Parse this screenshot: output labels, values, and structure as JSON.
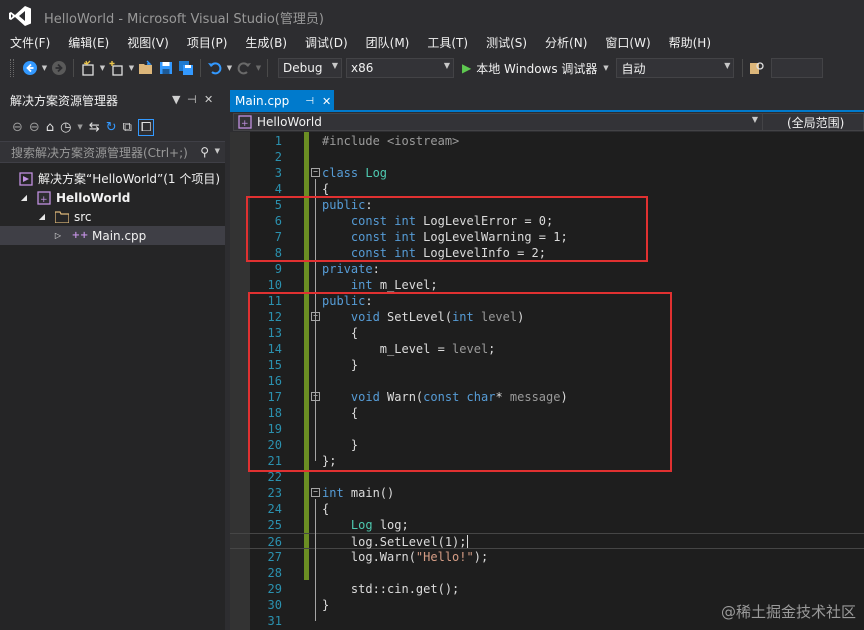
{
  "window": {
    "title": "HelloWorld - Microsoft Visual Studio(管理员)"
  },
  "menu": [
    "文件(F)",
    "编辑(E)",
    "视图(V)",
    "项目(P)",
    "生成(B)",
    "调试(D)",
    "团队(M)",
    "工具(T)",
    "测试(S)",
    "分析(N)",
    "窗口(W)",
    "帮助(H)"
  ],
  "toolbar": {
    "config": "Debug",
    "platform": "x86",
    "run_label": "本地 Windows 调试器",
    "run_mode": "自动"
  },
  "solution_explorer": {
    "title": "解决方案资源管理器",
    "search_placeholder": "搜索解决方案资源管理器(Ctrl+;)",
    "tree": [
      {
        "label": "解决方案“HelloWorld”(1 个项目)",
        "icon": "solution-icon",
        "bold": false
      },
      {
        "label": "HelloWorld",
        "icon": "cpp-project-icon",
        "bold": true
      },
      {
        "label": "src",
        "icon": "folder-icon",
        "bold": false
      },
      {
        "label": "Main.cpp",
        "icon": "cpp-file-icon",
        "bold": false,
        "selected": true
      }
    ]
  },
  "editor": {
    "tab": "Main.cpp",
    "nav_file": "HelloWorld",
    "nav_scope": "(全局范围)",
    "current_line": 26,
    "lines": [
      {
        "n": "1",
        "fold": "",
        "tokens": [
          {
            "t": "#include <iostream>",
            "c": "pp"
          }
        ]
      },
      {
        "n": "2",
        "fold": "",
        "tokens": []
      },
      {
        "n": "3",
        "fold": "minus",
        "tokens": [
          {
            "t": "class",
            "c": "kw"
          },
          {
            "t": " "
          },
          {
            "t": "Log",
            "c": "tp"
          }
        ]
      },
      {
        "n": "4",
        "fold": "",
        "tokens": [
          {
            "t": "{"
          }
        ]
      },
      {
        "n": "5",
        "fold": "",
        "tokens": [
          {
            "t": "public",
            "c": "kw"
          },
          {
            "t": ":"
          }
        ]
      },
      {
        "n": "6",
        "fold": "",
        "tokens": [
          {
            "t": "    "
          },
          {
            "t": "const",
            "c": "kw"
          },
          {
            "t": " "
          },
          {
            "t": "int",
            "c": "kw"
          },
          {
            "t": " LogLevelError = 0;"
          }
        ]
      },
      {
        "n": "7",
        "fold": "",
        "tokens": [
          {
            "t": "    "
          },
          {
            "t": "const",
            "c": "kw"
          },
          {
            "t": " "
          },
          {
            "t": "int",
            "c": "kw"
          },
          {
            "t": " LogLevelWarning = 1;"
          }
        ]
      },
      {
        "n": "8",
        "fold": "",
        "tokens": [
          {
            "t": "    "
          },
          {
            "t": "const",
            "c": "kw"
          },
          {
            "t": " "
          },
          {
            "t": "int",
            "c": "kw"
          },
          {
            "t": " LogLevelInfo = 2;"
          }
        ]
      },
      {
        "n": "9",
        "fold": "",
        "tokens": [
          {
            "t": "private",
            "c": "kw"
          },
          {
            "t": ":"
          }
        ]
      },
      {
        "n": "10",
        "fold": "",
        "tokens": [
          {
            "t": "    "
          },
          {
            "t": "int",
            "c": "kw"
          },
          {
            "t": " m_Level;"
          }
        ]
      },
      {
        "n": "11",
        "fold": "",
        "tokens": [
          {
            "t": "public",
            "c": "kw"
          },
          {
            "t": ":"
          }
        ]
      },
      {
        "n": "12",
        "fold": "minus",
        "tokens": [
          {
            "t": "    "
          },
          {
            "t": "void",
            "c": "kw"
          },
          {
            "t": " SetLevel("
          },
          {
            "t": "int",
            "c": "kw"
          },
          {
            "t": " "
          },
          {
            "t": "level",
            "c": "prm"
          },
          {
            "t": ")"
          }
        ]
      },
      {
        "n": "13",
        "fold": "",
        "tokens": [
          {
            "t": "    {"
          }
        ]
      },
      {
        "n": "14",
        "fold": "",
        "tokens": [
          {
            "t": "        m_Level = "
          },
          {
            "t": "level",
            "c": "prm"
          },
          {
            "t": ";"
          }
        ]
      },
      {
        "n": "15",
        "fold": "",
        "tokens": [
          {
            "t": "    }"
          }
        ]
      },
      {
        "n": "16",
        "fold": "",
        "tokens": []
      },
      {
        "n": "17",
        "fold": "minus",
        "tokens": [
          {
            "t": "    "
          },
          {
            "t": "void",
            "c": "kw"
          },
          {
            "t": " Warn("
          },
          {
            "t": "const",
            "c": "kw"
          },
          {
            "t": " "
          },
          {
            "t": "char",
            "c": "kw"
          },
          {
            "t": "* "
          },
          {
            "t": "message",
            "c": "prm"
          },
          {
            "t": ")"
          }
        ]
      },
      {
        "n": "18",
        "fold": "",
        "tokens": [
          {
            "t": "    {"
          }
        ]
      },
      {
        "n": "19",
        "fold": "",
        "tokens": []
      },
      {
        "n": "20",
        "fold": "",
        "tokens": [
          {
            "t": "    }"
          }
        ]
      },
      {
        "n": "21",
        "fold": "",
        "tokens": [
          {
            "t": "};"
          }
        ]
      },
      {
        "n": "22",
        "fold": "",
        "tokens": []
      },
      {
        "n": "23",
        "fold": "minus",
        "tokens": [
          {
            "t": "int",
            "c": "kw"
          },
          {
            "t": " main()"
          }
        ]
      },
      {
        "n": "24",
        "fold": "",
        "tokens": [
          {
            "t": "{"
          }
        ]
      },
      {
        "n": "25",
        "fold": "",
        "tokens": [
          {
            "t": "    "
          },
          {
            "t": "Log",
            "c": "tp"
          },
          {
            "t": " log;"
          }
        ]
      },
      {
        "n": "26",
        "fold": "",
        "tokens": [
          {
            "t": "    log.SetLevel(1);"
          }
        ]
      },
      {
        "n": "27",
        "fold": "",
        "tokens": [
          {
            "t": "    log.Warn("
          },
          {
            "t": "\"Hello!\"",
            "c": "str"
          },
          {
            "t": ");"
          }
        ]
      },
      {
        "n": "28",
        "fold": "",
        "tokens": []
      },
      {
        "n": "29",
        "fold": "",
        "tokens": [
          {
            "t": "    std::cin.get();"
          }
        ]
      },
      {
        "n": "30",
        "fold": "",
        "tokens": [
          {
            "t": "}"
          }
        ]
      },
      {
        "n": "31",
        "fold": "",
        "tokens": []
      }
    ]
  },
  "watermark": "@稀土掘金技术社区",
  "colors": {
    "accent": "#007acc",
    "annotation_box": "#e03131",
    "change_bar": "#6b8e23",
    "keyword": "#569cd6",
    "type": "#4ec9b0",
    "line_number": "#2b91af"
  }
}
